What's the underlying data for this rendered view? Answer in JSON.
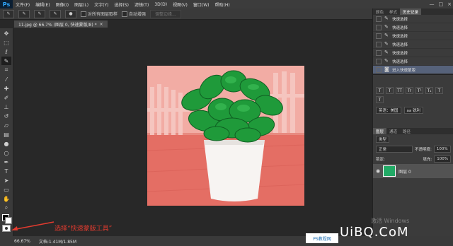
{
  "app": {
    "logo": "Ps"
  },
  "menubar": {
    "items": [
      "文件(F)",
      "编辑(E)",
      "图像(I)",
      "图层(L)",
      "文字(Y)",
      "选择(S)",
      "滤镜(T)",
      "3D(D)",
      "视图(V)",
      "窗口(W)",
      "帮助(H)"
    ],
    "controls": [
      "—",
      "□",
      "×"
    ]
  },
  "options": {
    "sample_all_layers": "对所有图层取样",
    "auto_enhance": "自动增强",
    "refine_edge": "调整边缘..."
  },
  "document": {
    "tab_title": "11.jpg @ 66.7% (图层 0, 快速蒙版/8) *",
    "close": "×"
  },
  "status": {
    "zoom": "66.67%",
    "doc_info": "文档:1.41M/1.85M"
  },
  "annotation": {
    "text": "选择“快速蒙版工具”"
  },
  "panels": {
    "history": {
      "tabs": [
        "颜色",
        "样式",
        "历史记录"
      ],
      "rows": [
        "快速选择",
        "快速选择",
        "快速选择",
        "快速选择",
        "快速选择",
        "快速选择",
        "进入快速蒙版"
      ]
    },
    "character": {
      "glyphs": [
        "T",
        "T",
        "TT",
        "Tr",
        "T¹",
        "T₁",
        "T",
        "T"
      ],
      "setting": "英语：美国",
      "aa": "aa 锐利"
    },
    "layers": {
      "tabs": [
        "图层",
        "通道",
        "路径"
      ],
      "kind": "类型",
      "blend": "正常",
      "opacity_label": "不透明度:",
      "opacity": "100%",
      "lock_label": "锁定:",
      "fill_label": "填充:",
      "fill": "100%",
      "layer_name": "图层 0"
    }
  },
  "watermarks": {
    "windows": "激活 Windows",
    "site": "UiBQ.CoM",
    "badge": "PS教程网"
  },
  "colors": {
    "mask_overlay": "#e8827a",
    "selected_history": "#56627a",
    "annotation": "#e23b2f"
  }
}
